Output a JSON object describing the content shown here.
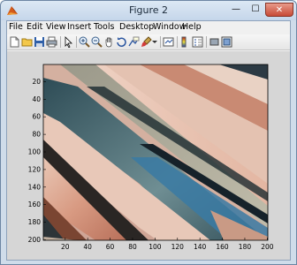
{
  "window": {
    "title": "Figure 2",
    "minimize_glyph": "—",
    "maximize_glyph": "☐",
    "close_glyph": "✕"
  },
  "menu": {
    "items": [
      {
        "label": "File",
        "x": 2
      },
      {
        "label": "Edit",
        "x": 22
      },
      {
        "label": "View",
        "x": 44
      },
      {
        "label": "Insert",
        "x": 68
      },
      {
        "label": "Tools",
        "x": 98
      },
      {
        "label": "Desktop",
        "x": 127
      },
      {
        "label": "Window",
        "x": 165
      },
      {
        "label": "Help",
        "x": 198
      }
    ]
  },
  "toolbar": {
    "icons": [
      "new-figure-icon",
      "open-file-icon",
      "save-icon",
      "print-icon",
      "pointer-icon",
      "zoom-in-icon",
      "zoom-out-icon",
      "pan-icon",
      "rotate-3d-icon",
      "data-cursor-icon",
      "brush-icon",
      "brush-dropdown-icon",
      "link-plot-icon",
      "colorbar-icon",
      "legend-icon",
      "hide-plot-tools-icon",
      "show-plot-tools-icon"
    ]
  },
  "axes": {
    "y_ticks": [
      "20",
      "40",
      "60",
      "80",
      "100",
      "120",
      "140",
      "160",
      "180",
      "200"
    ],
    "x_ticks": [
      "20",
      "40",
      "60",
      "80",
      "100",
      "120",
      "140",
      "160",
      "180",
      "200"
    ],
    "xlim": [
      0.5,
      200.5
    ],
    "ylim": [
      0.5,
      200.5
    ],
    "y_direction": "reverse"
  },
  "colors": {
    "window_frame": "#cfdcea",
    "close_button": "#c74a36",
    "figure_background": "#d6d6d6"
  }
}
